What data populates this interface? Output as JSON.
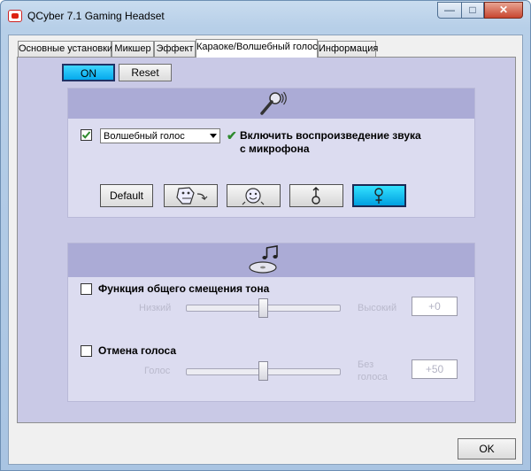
{
  "window": {
    "title": "QCyber 7.1 Gaming Headset",
    "controls": {
      "minimize": "—",
      "maximize": "□",
      "close": "✕"
    }
  },
  "tabs": [
    {
      "label": "Основные установки",
      "active": false
    },
    {
      "label": "Микшер",
      "active": false
    },
    {
      "label": "Эффект",
      "active": false
    },
    {
      "label": "Караоке/Волшебный голос",
      "active": true
    },
    {
      "label": "Информация",
      "active": false
    }
  ],
  "toolbar": {
    "on_label": "ON",
    "reset_label": "Reset"
  },
  "magic_voice": {
    "icon": "microphone-icon",
    "checked": true,
    "mode_select": "Волшебный голос",
    "monitor_check": "✔",
    "monitor_text_line1": "Включить воспроизведение звука",
    "monitor_text_line2": "с микрофона",
    "default_label": "Default",
    "voice_buttons": [
      {
        "icon": "monster-icon",
        "active": false
      },
      {
        "icon": "cartoon-face-icon",
        "active": false
      },
      {
        "icon": "male-symbol-icon",
        "active": false
      },
      {
        "icon": "female-symbol-icon",
        "active": true
      }
    ]
  },
  "karaoke": {
    "icon": "music-disc-icon",
    "pitch": {
      "label": "Функция общего смещения тона",
      "checked": false,
      "low_label": "Низкий",
      "high_label": "Высокий",
      "value": "+0",
      "position": 0.5
    },
    "vocal_cancel": {
      "label": "Отмена голоса",
      "checked": false,
      "left_label": "Голос",
      "right_label_line1": "Без",
      "right_label_line2": "голоса",
      "value": "+50",
      "position": 0.5
    }
  },
  "footer": {
    "ok_label": "OK"
  },
  "colors": {
    "accent_on": "#00b4ff",
    "panel": "#c9c9e6",
    "group_header": "#ababd6"
  }
}
